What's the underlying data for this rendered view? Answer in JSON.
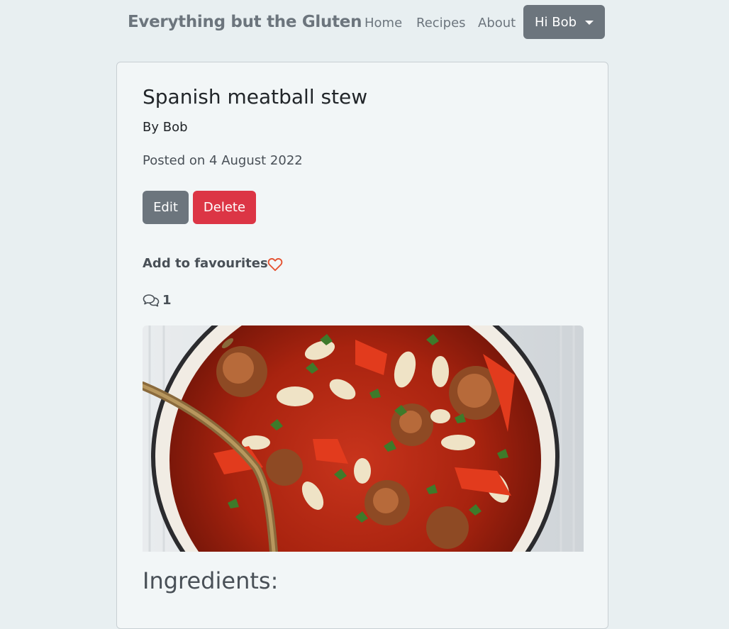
{
  "navbar": {
    "brand": "Everything but the Gluten",
    "links": [
      "Home",
      "Recipes",
      "About"
    ],
    "user_menu": "Hi Bob"
  },
  "recipe": {
    "title": "Spanish meatball stew",
    "author": "By Bob",
    "posted": "Posted on 4 August 2022",
    "edit_label": "Edit",
    "delete_label": "Delete",
    "favourite_label": "Add to favourites",
    "favourite_icon": "heart-outline-icon",
    "comment_icon": "chat-bubbles-icon",
    "comment_count": "1",
    "image_description": "photo-spanish-meatball-stew",
    "ingredients_heading": "Ingredients:"
  },
  "colors": {
    "secondary": "#6c757d",
    "danger": "#dc3545",
    "heart": "#e4502e",
    "page_bg": "#e8eff1",
    "card_bg": "#f2f6f7"
  }
}
